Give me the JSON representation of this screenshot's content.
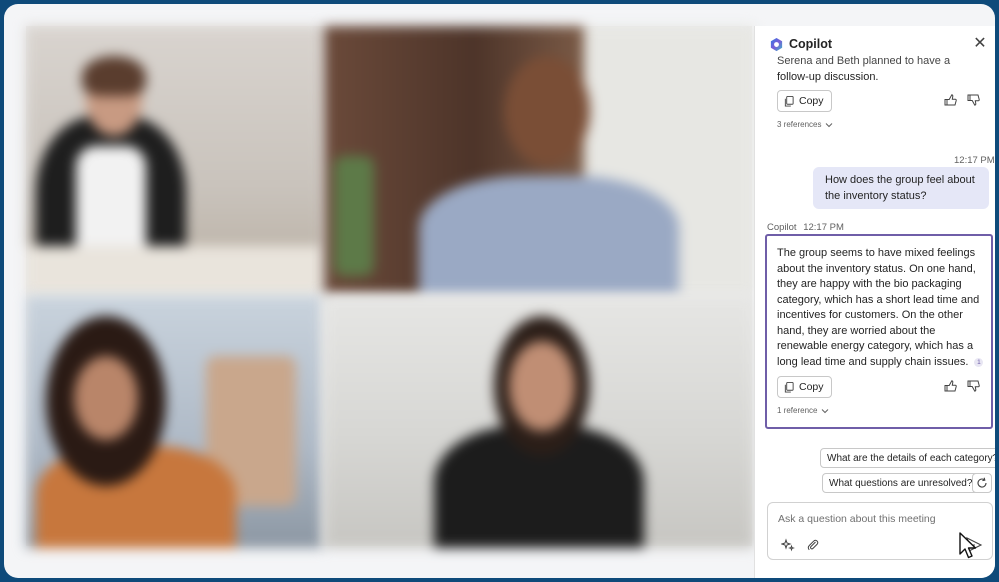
{
  "panel": {
    "title": "Copilot",
    "close_label": "✕"
  },
  "previous_message": {
    "text_lines": [
      "Serena and Beth planned to have a",
      "follow-up discussion."
    ],
    "copy_label": "Copy",
    "references_label": "3 references"
  },
  "user_message": {
    "time": "12:17 PM",
    "text": "How does the group feel about the inventory status?"
  },
  "copilot_message": {
    "sender": "Copilot",
    "time": "12:17 PM",
    "text_lines": [
      "The group seems to have mixed feelings",
      "about the inventory status. On one hand,",
      "they are happy with the bio packaging",
      "category, which has a short lead time and",
      "incentives for customers. On the other",
      "hand, they are worried about the",
      "renewable energy category, which has a",
      "long lead time and supply chain issues."
    ],
    "citation": "1",
    "copy_label": "Copy",
    "references_label": "1 reference"
  },
  "suggestions": [
    "What are the details of each category?",
    "What questions are unresolved?"
  ],
  "input": {
    "placeholder": "Ask a question about this meeting"
  },
  "colors": {
    "background": "#0e4a7a",
    "answer_border": "#6f5ea8",
    "user_bubble": "#e5e7f7"
  }
}
